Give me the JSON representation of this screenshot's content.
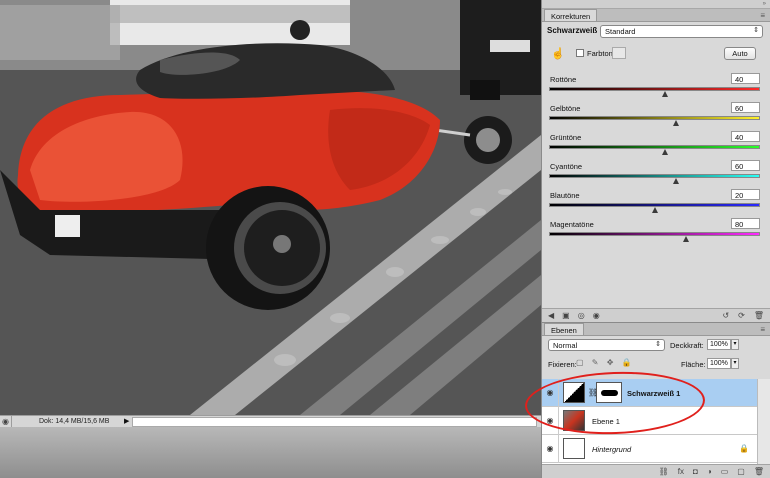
{
  "status": {
    "doc_info": "Dok: 14,4 MB/15,6 MB"
  },
  "adjustments": {
    "tab": "Korrekturen",
    "title": "Schwarzweiß",
    "preset": "Standard",
    "tint_label": "Farbton",
    "auto_label": "Auto",
    "sliders": [
      {
        "label": "Rottöne",
        "value": "40",
        "pct": 0.55,
        "gradient": "linear-gradient(90deg,#000,#ff2a2a)"
      },
      {
        "label": "Gelbtöne",
        "value": "60",
        "pct": 0.6,
        "gradient": "linear-gradient(90deg,#000,#fff12a)"
      },
      {
        "label": "Grüntöne",
        "value": "40",
        "pct": 0.55,
        "gradient": "linear-gradient(90deg,#000,#2aff2a)"
      },
      {
        "label": "Cyantöne",
        "value": "60",
        "pct": 0.6,
        "gradient": "linear-gradient(90deg,#000,#2afff5)"
      },
      {
        "label": "Blautöne",
        "value": "20",
        "pct": 0.5,
        "gradient": "linear-gradient(90deg,#000,#2a2aff)"
      },
      {
        "label": "Magentatöne",
        "value": "80",
        "pct": 0.65,
        "gradient": "linear-gradient(90deg,#000,#ff2aff)"
      }
    ]
  },
  "layers": {
    "tab": "Ebenen",
    "blend_mode": "Normal",
    "opacity_label": "Deckkraft:",
    "opacity_value": "100%",
    "lock_label": "Fixieren:",
    "fill_label": "Fläche:",
    "fill_value": "100%",
    "items": [
      {
        "name": "Schwarzweiß 1",
        "selected": true
      },
      {
        "name": "Ebene 1",
        "selected": false
      },
      {
        "name": "Hintergrund",
        "selected": false
      }
    ]
  },
  "colors": {
    "highlight_circle": "#e0201c",
    "selected_layer": "#a9cef2",
    "car_red": "#d8321e"
  }
}
